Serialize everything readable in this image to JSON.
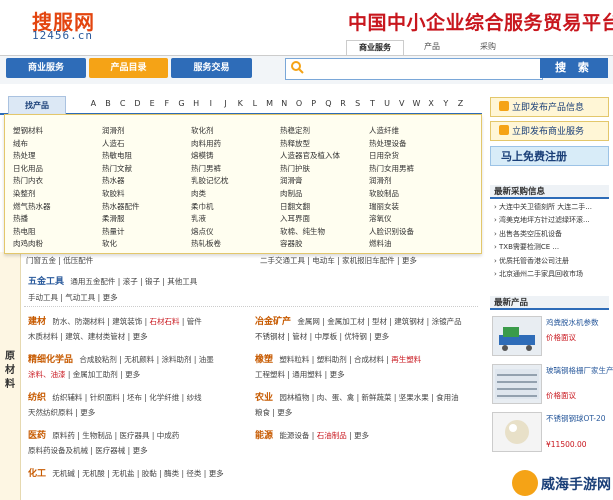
{
  "logo": {
    "text": "搜服网",
    "sub": "12456.cn"
  },
  "site_title": "中国中小企业综合服务贸易平台",
  "header_tabs": [
    "商业服务",
    "产品",
    "采购"
  ],
  "nav_buttons": [
    "商业服务",
    "产品目录",
    "服务交易"
  ],
  "search": {
    "placeholder": "",
    "button": "搜 索"
  },
  "alpha": {
    "tab": "找产品",
    "letters": [
      "A",
      "B",
      "C",
      "D",
      "E",
      "F",
      "G",
      "H",
      "I",
      "J",
      "K",
      "L",
      "M",
      "N",
      "O",
      "P",
      "Q",
      "R",
      "S",
      "T",
      "U",
      "V",
      "W",
      "X",
      "Y",
      "Z"
    ]
  },
  "popup_items": [
    "塑钢材料",
    "润滑剂",
    "软化剂",
    "热稳定剂",
    "人造纤维",
    "绒布",
    "人造石",
    "肉料用药",
    "热释放型",
    "热处理设备",
    "热处理",
    "热敏电阻",
    "熔模铸",
    "人造器官及植入体",
    "日用杂货",
    "日化用品",
    "热门文献",
    "热门男裤",
    "热门护肤",
    "热门女用男裤",
    "热门内衣",
    "热水器",
    "乳胶记忆枕",
    "润滑膏",
    "润滑剂",
    "染整剂",
    "软胶料",
    "肉类",
    "肉制品",
    "软胶制品",
    "燃气热水器",
    "热水器配件",
    "柔巾机",
    "日翻文翻",
    "瑞丽女装",
    "热播",
    "柔滑服",
    "乳液",
    "入耳界面",
    "溶氧仪",
    "热电阻",
    "热量计",
    "熔点仪",
    "软棉、纯生物",
    "人脸识别设备",
    "肉鸡肉粉",
    "软化",
    "热轧板卷",
    "容器胶",
    "燃料油"
  ],
  "partial_row": {
    "left": "门窗五金 | 低压配件",
    "mid": "二手交通工具 | 电动车 | 家机报旧车配件 | 更多"
  },
  "sections": {
    "hardware": {
      "title": "五金工具",
      "items": [
        "通用五金配件",
        "滚子",
        "锻子",
        "其他工具"
      ],
      "line2": [
        "手动工具",
        "气动工具",
        "更多"
      ]
    },
    "building": {
      "title": "建材",
      "items": [
        "防水、防潮材料",
        "建筑装饰",
        "石材石料",
        "管件"
      ],
      "line2": [
        "木质材料",
        "建筑、建材类管材",
        "更多"
      ]
    },
    "metallurgy": {
      "title": "冶金矿产",
      "items": [
        "金属网",
        "金属加工材",
        "型材",
        "建筑钢材",
        "涂镀产品"
      ],
      "line2": [
        "不锈钢材",
        "管材",
        "中厚板",
        "优特钢",
        "更多"
      ]
    },
    "chemical": {
      "title": "精细化学品",
      "items": [
        "合成胶粘剂",
        "无机颜料",
        "涂料助剂",
        "油墨"
      ],
      "line2": [
        "涂料、油漆",
        "金属加工助剂",
        "更多"
      ]
    },
    "plastic": {
      "title": "橡塑",
      "items": [
        "塑料粒料",
        "塑料助剂",
        "合成材料",
        "再生塑料"
      ],
      "line2": [
        "工程塑料",
        "通用塑料",
        "更多"
      ]
    },
    "textile": {
      "title": "纺织",
      "items": [
        "纺织辅料",
        "针织面料",
        "坯布",
        "化学纤维",
        "纱线"
      ],
      "line2": [
        "天然纺织原料",
        "更多"
      ]
    },
    "agri": {
      "title": "农业",
      "items": [
        "园林植物",
        "肉、蛋、禽",
        "新鲜蔬菜",
        "坚果水果",
        "食用油"
      ],
      "line2": [
        "粮食",
        "更多"
      ]
    },
    "medicine": {
      "title": "医药",
      "items": [
        "原料药",
        "生物制品",
        "医疗器具",
        "中成药"
      ],
      "line2": [
        "原料药设备及机械",
        "医疗器械",
        "更多"
      ]
    },
    "energy": {
      "title": "能源",
      "items": [
        "能源设备",
        "石油制品",
        "更多"
      ]
    },
    "chem": {
      "title": "化工",
      "items": [
        "无机碱",
        "无机酸",
        "无机盐",
        "胶黏",
        "酶类",
        "径类",
        "更多"
      ]
    }
  },
  "left_label": "原材料",
  "right": {
    "btn_publish_product": "立即发布产品信息",
    "btn_publish_service": "立即发布商业服务",
    "free_register": "马上免费注册",
    "purchase_head": "最新采购信息",
    "purchase_items": [
      "大连中关卫德刻所 大连二手...",
      "湾美克地坪方针过滤绿环滚...",
      "出售各类空压机设备",
      "TXB需要检测CE ...",
      "优质托管香港公司注册",
      "北京通州二手家具回收市场"
    ],
    "product_head": "最新产品",
    "products": [
      {
        "name": "鸡粪脱水机参数",
        "price": "价格面议"
      },
      {
        "name": "玻璃钢格栅厂家生产直销...",
        "price": "价格面议"
      },
      {
        "name": "不锈钢钢球OT-20",
        "price": "¥11500.00"
      }
    ],
    "watermark": "威海手游网"
  },
  "colors": {
    "brand_red": "#c8161d",
    "nav_blue": "#2e6cb8",
    "nav_orange": "#f5a316"
  }
}
